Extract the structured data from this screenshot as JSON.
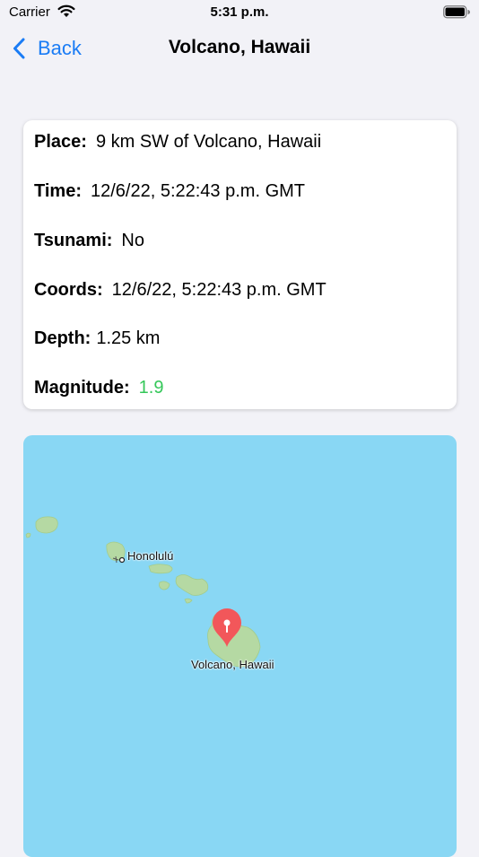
{
  "status": {
    "carrier": "Carrier",
    "time": "5:31 p.m."
  },
  "nav": {
    "back_label": "Back",
    "title": "Volcano, Hawaii"
  },
  "details": {
    "place": {
      "label": "Place:",
      "value": "9 km SW of Volcano, Hawaii"
    },
    "time": {
      "label": "Time:",
      "value": "12/6/22, 5:22:43 p.m. GMT"
    },
    "tsunami": {
      "label": "Tsunami:",
      "value": "No"
    },
    "coords": {
      "label": "Coords:",
      "value": "12/6/22, 5:22:43 p.m. GMT"
    },
    "depth": {
      "label": "Depth:",
      "value": "1.25 km"
    },
    "magnitude": {
      "label": "Magnitude:",
      "value": "1.9"
    }
  },
  "map": {
    "city_label": "Honolulú",
    "pin_label": "Volcano, Hawaii",
    "pin_color": "#f2575a",
    "water_color": "#89d7f4",
    "land_color": "#b5d9a3"
  }
}
